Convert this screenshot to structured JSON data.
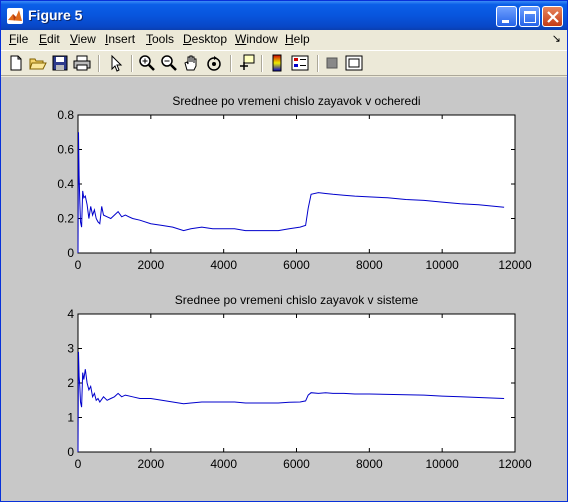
{
  "window": {
    "title": "Figure 5",
    "controls": [
      "minimize",
      "maximize",
      "close"
    ]
  },
  "menu": {
    "items": [
      {
        "key": "F",
        "rest": "ile"
      },
      {
        "key": "E",
        "rest": "dit"
      },
      {
        "key": "V",
        "rest": "iew"
      },
      {
        "key": "I",
        "rest": "nsert"
      },
      {
        "key": "T",
        "rest": "ools"
      },
      {
        "key": "D",
        "rest": "esktop"
      },
      {
        "key": "W",
        "rest": "indow"
      },
      {
        "key": "H",
        "rest": "elp"
      }
    ],
    "dock_arrow": "↘"
  },
  "toolbar": {
    "icons": [
      "new-file-icon",
      "open-folder-icon",
      "save-icon",
      "print-icon",
      "pointer-icon",
      "zoom-in-icon",
      "zoom-out-icon",
      "pan-hand-icon",
      "rotate-3d-icon",
      "data-cursor-icon",
      "colorbar-icon",
      "legend-icon",
      "hide-plot-tools-icon",
      "show-plot-tools-icon"
    ]
  },
  "chart_data": [
    {
      "type": "line",
      "title": "Srednee po vremeni chislo zayavok v ocheredi",
      "xlim": [
        0,
        12000
      ],
      "ylim": [
        0,
        0.8
      ],
      "xticks": [
        "0",
        "2000",
        "4000",
        "6000",
        "8000",
        "10000",
        "12000"
      ],
      "yticks": [
        "0",
        "0.2",
        "0.4",
        "0.6",
        "0.8"
      ],
      "color": "#0000cc",
      "x": [
        0,
        15,
        30,
        50,
        70,
        100,
        130,
        160,
        200,
        250,
        300,
        350,
        400,
        450,
        500,
        550,
        600,
        650,
        700,
        800,
        900,
        1000,
        1100,
        1200,
        1300,
        1500,
        1700,
        2000,
        2300,
        2600,
        2900,
        3100,
        3400,
        3700,
        4000,
        4300,
        4600,
        4900,
        5200,
        5500,
        5800,
        6100,
        6250,
        6320,
        6400,
        6600,
        6800,
        7000,
        7300,
        7600,
        8000,
        8500,
        9000,
        9500,
        10000,
        10500,
        11000,
        11700
      ],
      "y": [
        0.0,
        0.7,
        0.45,
        0.3,
        0.18,
        0.15,
        0.36,
        0.32,
        0.33,
        0.28,
        0.2,
        0.27,
        0.22,
        0.25,
        0.2,
        0.18,
        0.17,
        0.27,
        0.22,
        0.21,
        0.2,
        0.22,
        0.24,
        0.21,
        0.22,
        0.2,
        0.19,
        0.17,
        0.16,
        0.15,
        0.13,
        0.14,
        0.15,
        0.14,
        0.14,
        0.14,
        0.13,
        0.13,
        0.13,
        0.13,
        0.14,
        0.15,
        0.16,
        0.26,
        0.34,
        0.35,
        0.345,
        0.34,
        0.335,
        0.33,
        0.325,
        0.32,
        0.31,
        0.305,
        0.295,
        0.285,
        0.28,
        0.265
      ]
    },
    {
      "type": "line",
      "title": "Srednee po vremeni chislo zayavok v sisteme",
      "xlim": [
        0,
        12000
      ],
      "ylim": [
        0,
        4
      ],
      "xticks": [
        "0",
        "2000",
        "4000",
        "6000",
        "8000",
        "10000",
        "12000"
      ],
      "yticks": [
        "0",
        "1",
        "2",
        "3",
        "4"
      ],
      "color": "#0000cc",
      "x": [
        0,
        15,
        30,
        50,
        70,
        100,
        130,
        160,
        200,
        250,
        300,
        350,
        400,
        450,
        500,
        550,
        600,
        700,
        800,
        900,
        1000,
        1100,
        1200,
        1300,
        1500,
        1700,
        2000,
        2300,
        2600,
        2900,
        3100,
        3400,
        3700,
        4000,
        4300,
        4600,
        4900,
        5200,
        5500,
        5800,
        6100,
        6250,
        6320,
        6400,
        6600,
        6800,
        7000,
        7300,
        7600,
        8000,
        8500,
        9000,
        9500,
        10000,
        10500,
        11000,
        11700
      ],
      "y": [
        0.0,
        2.9,
        2.2,
        1.9,
        1.45,
        1.3,
        2.3,
        2.1,
        2.4,
        2.0,
        1.8,
        1.9,
        1.6,
        1.7,
        1.5,
        1.55,
        1.45,
        1.6,
        1.5,
        1.55,
        1.6,
        1.7,
        1.6,
        1.65,
        1.6,
        1.55,
        1.55,
        1.5,
        1.45,
        1.4,
        1.42,
        1.45,
        1.45,
        1.45,
        1.45,
        1.42,
        1.42,
        1.42,
        1.42,
        1.44,
        1.45,
        1.48,
        1.65,
        1.72,
        1.7,
        1.72,
        1.7,
        1.7,
        1.68,
        1.68,
        1.67,
        1.66,
        1.65,
        1.62,
        1.6,
        1.58,
        1.55
      ]
    }
  ]
}
